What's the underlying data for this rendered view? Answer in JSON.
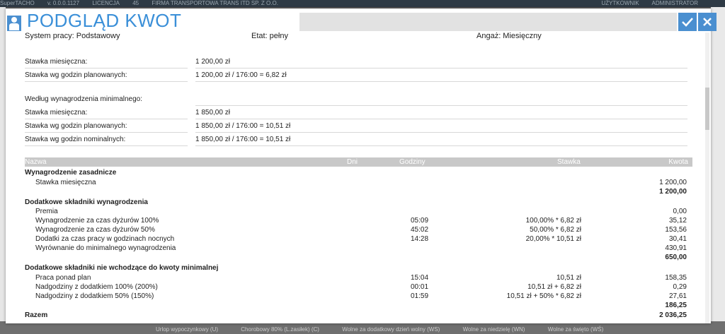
{
  "app_bar": {
    "app_name": "SuperTACHO",
    "version": "v. 0.0.0.1127",
    "licence_label": "LICENCJA",
    "licence_value": "45",
    "user_label": "UŻYTKOWNIK",
    "user_value": "ADMINISTRATOR",
    "company": "FIRMA TRANSPORTOWA TRANS ITD SP. Z O.O."
  },
  "dialog": {
    "title": "PODGLĄD KWOT",
    "ok_icon": "check-icon",
    "close_icon": "close-icon"
  },
  "info": {
    "system_pracy": "System pracy: Podstawowy",
    "etat": "Etat: pełny",
    "angaz": "Angaż: Miesięczny"
  },
  "rates": [
    {
      "label": "Stawka miesięczna:",
      "value": "1 200,00 zł"
    },
    {
      "label": "Stawka wg godzin planowanych:",
      "value": "1 200,00 zł / 176:00 = 6,82 zł"
    }
  ],
  "min_wage": {
    "heading": "Według wynagrodzenia minimalnego:",
    "rows": [
      {
        "label": "Stawka miesięczna:",
        "value": "1 850,00 zł"
      },
      {
        "label": "Stawka wg godzin planowanych:",
        "value": "1 850,00 zł / 176:00 = 10,51 zł"
      },
      {
        "label": "Stawka wg godzin nominalnych:",
        "value": "1 850,00 zł / 176:00 = 10,51 zł"
      }
    ]
  },
  "table": {
    "headers": {
      "nazwa": "Nazwa",
      "dni": "Dni",
      "godziny": "Godziny",
      "stawka": "Stawka",
      "kwota": "Kwota"
    },
    "sections": [
      {
        "title": "Wynagrodzenie zasadnicze",
        "rows": [
          {
            "name": "Stawka miesięczna",
            "godziny": "",
            "stawka": "",
            "kwota": "1 200,00"
          }
        ],
        "total": "1 200,00"
      },
      {
        "title": "Dodatkowe składniki wynagrodzenia",
        "rows": [
          {
            "name": "Premia",
            "godziny": "",
            "stawka": "",
            "kwota": "0,00"
          },
          {
            "name": "Wynagrodzenie za czas dyżurów 100%",
            "godziny": "05:09",
            "stawka": "100,00% * 6,82 zł",
            "kwota": "35,12"
          },
          {
            "name": "Wynagrodzenie za czas dyżurów 50%",
            "godziny": "45:02",
            "stawka": "50,00% * 6,82 zł",
            "kwota": "153,56"
          },
          {
            "name": "Dodatki za czas pracy w godzinach nocnych",
            "godziny": "14:28",
            "stawka": "20,00% * 10,51 zł",
            "kwota": "30,41"
          },
          {
            "name": "Wyrównanie do minimalnego wynagrodzenia",
            "godziny": "",
            "stawka": "",
            "kwota": "430,91"
          }
        ],
        "total": "650,00"
      },
      {
        "title": "Dodatkowe składniki nie wchodzące do kwoty minimalnej",
        "rows": [
          {
            "name": "Praca ponad plan",
            "godziny": "15:04",
            "stawka": "10,51 zł",
            "kwota": "158,35"
          },
          {
            "name": "Nadgodziny z dodatkiem 100% (200%)",
            "godziny": "00:01",
            "stawka": "10,51 zł + 6,82 zł",
            "kwota": "0,29"
          },
          {
            "name": "Nadgodziny z dodatkiem 50% (150%)",
            "godziny": "01:59",
            "stawka": "10,51 zł + 50% * 6,82 zł",
            "kwota": "27,61"
          }
        ],
        "total": "186,25"
      }
    ],
    "razem_label": "Razem",
    "razem_value": "2 036,25"
  },
  "bottom_tabs": [
    "Urlop wypoczynkowy (U)",
    "Chorobowy 80% (L.zasiłek) (C)",
    "Wolne za dodatkowy dzień wolny (WS)",
    "Wolne za niedzielę (WN)",
    "Wolne za święto (WŚ)"
  ],
  "colors": {
    "accent": "#4a8fd0",
    "title": "#3a8fd8",
    "header_bg": "#c8c8c8"
  }
}
